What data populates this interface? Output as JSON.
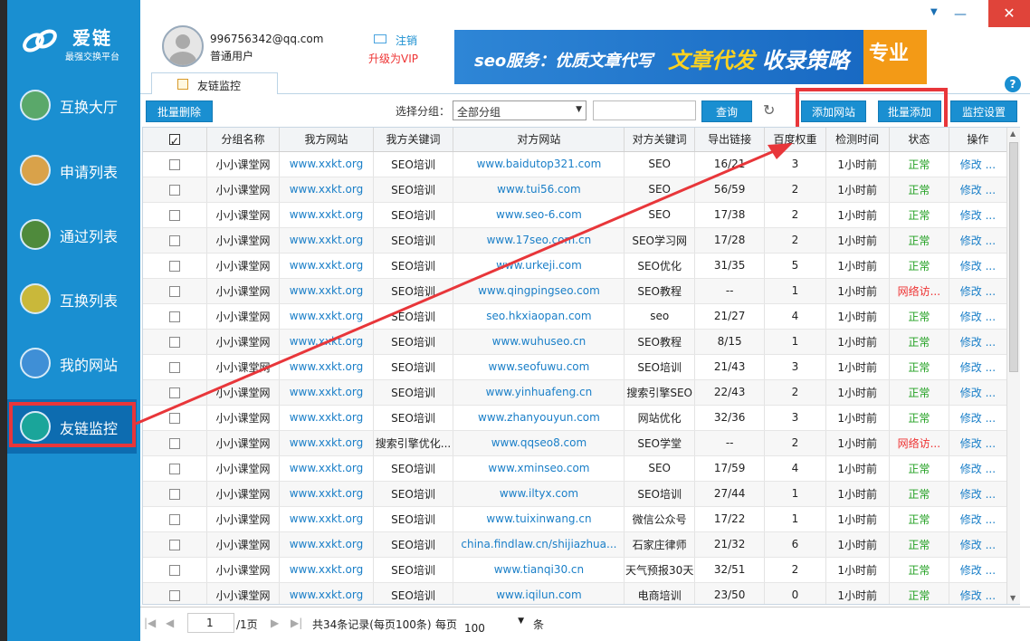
{
  "app": {
    "logo_name": "爱链",
    "logo_slogan": "最强交换平台"
  },
  "sidebar": {
    "items": [
      {
        "label": "互换大厅",
        "icon": "bank-icon"
      },
      {
        "label": "申请列表",
        "icon": "inbox-icon"
      },
      {
        "label": "通过列表",
        "icon": "check-icon"
      },
      {
        "label": "互换列表",
        "icon": "exchange-icon"
      },
      {
        "label": "我的网站",
        "icon": "layers-icon"
      },
      {
        "label": "友链监控",
        "icon": "pulse-icon"
      }
    ]
  },
  "header": {
    "email": "996756342@qq.com",
    "user_type": "普通用户",
    "logout": "注销",
    "vip": "升级为VIP",
    "banner": {
      "t1": "seo服务：优质文章代写",
      "t2": "文章代发",
      "t3": "收录策略",
      "t4": "专业"
    },
    "help": "?",
    "tab": "友链监控"
  },
  "toolbar": {
    "batch_delete": "批量删除",
    "group_label": "选择分组：",
    "group_value": "全部分组",
    "search_placeholder": "",
    "query": "查询",
    "add_site": "添加网站",
    "batch_add": "批量添加",
    "monitor_settings": "监控设置"
  },
  "table": {
    "headers": [
      "分组名称",
      "我方网站",
      "我方关键词",
      "对方网站",
      "对方关键词",
      "导出链接",
      "百度权重",
      "检测时间",
      "状态",
      "操作"
    ],
    "rows": [
      [
        "小小课堂网",
        "www.xxkt.org",
        "SEO培训",
        "www.baidutop321.com",
        "SEO",
        "16/21",
        "3",
        "1小时前",
        "正常",
        "修改 ..."
      ],
      [
        "小小课堂网",
        "www.xxkt.org",
        "SEO培训",
        "www.tui56.com",
        "SEO",
        "56/59",
        "2",
        "1小时前",
        "正常",
        "修改 ..."
      ],
      [
        "小小课堂网",
        "www.xxkt.org",
        "SEO培训",
        "www.seo-6.com",
        "SEO",
        "17/38",
        "2",
        "1小时前",
        "正常",
        "修改 ..."
      ],
      [
        "小小课堂网",
        "www.xxkt.org",
        "SEO培训",
        "www.17seo.com.cn",
        "SEO学习网",
        "17/28",
        "2",
        "1小时前",
        "正常",
        "修改 ..."
      ],
      [
        "小小课堂网",
        "www.xxkt.org",
        "SEO培训",
        "www.urkeji.com",
        "SEO优化",
        "31/35",
        "5",
        "1小时前",
        "正常",
        "修改 ..."
      ],
      [
        "小小课堂网",
        "www.xxkt.org",
        "SEO培训",
        "www.qingpingseo.com",
        "SEO教程",
        "--",
        "1",
        "1小时前",
        "网络访...",
        "修改 ..."
      ],
      [
        "小小课堂网",
        "www.xxkt.org",
        "SEO培训",
        "seo.hkxiaopan.com",
        "seo",
        "21/27",
        "4",
        "1小时前",
        "正常",
        "修改 ..."
      ],
      [
        "小小课堂网",
        "www.xxkt.org",
        "SEO培训",
        "www.wuhuseo.cn",
        "SEO教程",
        "8/15",
        "1",
        "1小时前",
        "正常",
        "修改 ..."
      ],
      [
        "小小课堂网",
        "www.xxkt.org",
        "SEO培训",
        "www.seofuwu.com",
        "SEO培训",
        "21/43",
        "3",
        "1小时前",
        "正常",
        "修改 ..."
      ],
      [
        "小小课堂网",
        "www.xxkt.org",
        "SEO培训",
        "www.yinhuafeng.cn",
        "搜索引擎SEO",
        "22/43",
        "2",
        "1小时前",
        "正常",
        "修改 ..."
      ],
      [
        "小小课堂网",
        "www.xxkt.org",
        "SEO培训",
        "www.zhanyouyun.com",
        "网站优化",
        "32/36",
        "3",
        "1小时前",
        "正常",
        "修改 ..."
      ],
      [
        "小小课堂网",
        "www.xxkt.org",
        "搜索引擎优化...",
        "www.qqseo8.com",
        "SEO学堂",
        "--",
        "2",
        "1小时前",
        "网络访...",
        "修改 ..."
      ],
      [
        "小小课堂网",
        "www.xxkt.org",
        "SEO培训",
        "www.xminseo.com",
        "SEO",
        "17/59",
        "4",
        "1小时前",
        "正常",
        "修改 ..."
      ],
      [
        "小小课堂网",
        "www.xxkt.org",
        "SEO培训",
        "www.iltyx.com",
        "SEO培训",
        "27/44",
        "1",
        "1小时前",
        "正常",
        "修改 ..."
      ],
      [
        "小小课堂网",
        "www.xxkt.org",
        "SEO培训",
        "www.tuixinwang.cn",
        "微信公众号",
        "17/22",
        "1",
        "1小时前",
        "正常",
        "修改 ..."
      ],
      [
        "小小课堂网",
        "www.xxkt.org",
        "SEO培训",
        "china.findlaw.cn/shijiazhua...",
        "石家庄律师",
        "21/32",
        "6",
        "1小时前",
        "正常",
        "修改 ..."
      ],
      [
        "小小课堂网",
        "www.xxkt.org",
        "SEO培训",
        "www.tianqi30.cn",
        "天气预报30天",
        "32/51",
        "2",
        "1小时前",
        "正常",
        "修改 ..."
      ],
      [
        "小小课堂网",
        "www.xxkt.org",
        "SEO培训",
        "www.iqilun.com",
        "电商培训",
        "23/50",
        "0",
        "1小时前",
        "正常",
        "修改 ..."
      ]
    ]
  },
  "pager": {
    "current": "1",
    "total_pages": "/1页",
    "info": "共34条记录(每页100条)",
    "per_label": "每页",
    "size": "100",
    "tiao": "条"
  },
  "colors": {
    "sidebar": "#1a8fd1",
    "accent": "#1a8fd1",
    "highlight": "#e8363a",
    "ok": "#22a022",
    "error": "#e33333"
  }
}
